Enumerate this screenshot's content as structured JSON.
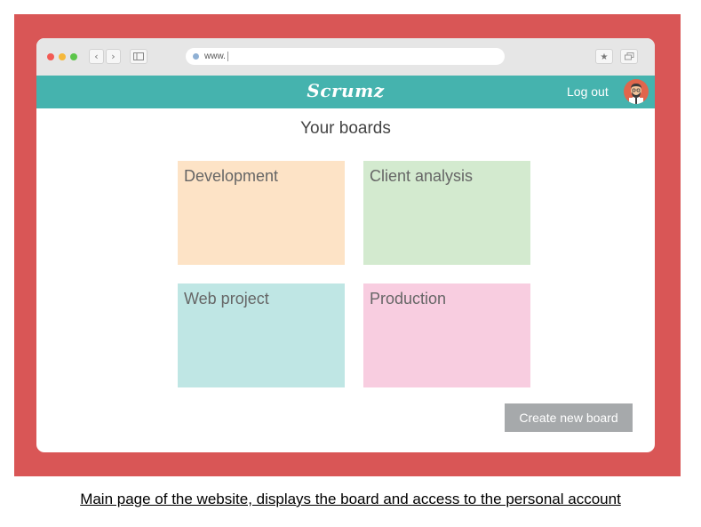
{
  "browser": {
    "url": "www.",
    "bookmark_icon": "star-icon",
    "tabs_icon": "tabs-icon"
  },
  "header": {
    "logo": "Scrumz",
    "logout_label": "Log out"
  },
  "main": {
    "title": "Your boards",
    "boards": [
      {
        "name": "Development",
        "color": "#fde3c6"
      },
      {
        "name": "Client analysis",
        "color": "#d3eacf"
      },
      {
        "name": "Web project",
        "color": "#bfe6e4"
      },
      {
        "name": "Production",
        "color": "#f8cde0"
      }
    ],
    "create_button_label": "Create new board"
  },
  "colors": {
    "frame": "#d95656",
    "header": "#45b3ae",
    "button": "#a6a9ab"
  },
  "caption": "Main page of the website, displays the board and access to the personal account"
}
